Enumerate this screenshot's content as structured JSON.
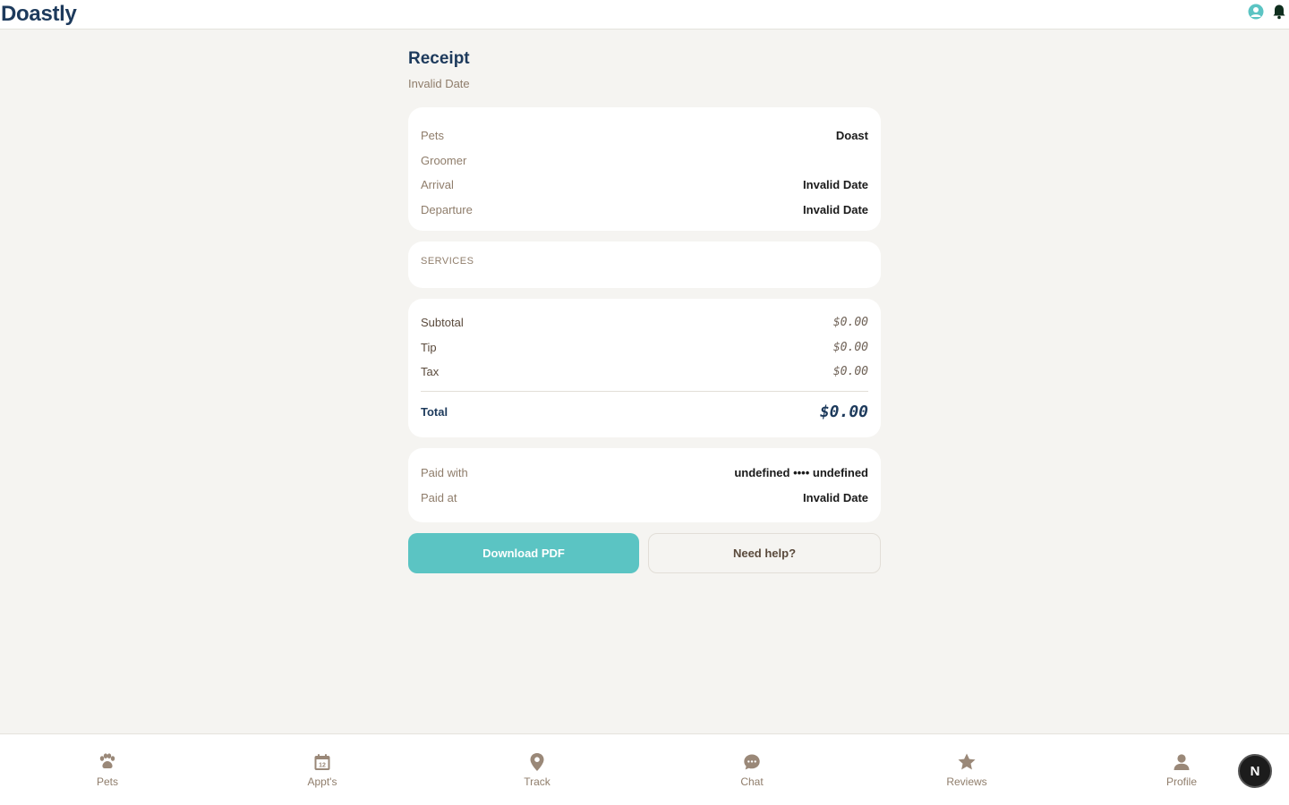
{
  "app": {
    "brand": "Doastly"
  },
  "header_icons": [
    "user-circle-icon",
    "bell-icon"
  ],
  "receipt": {
    "title": "Receipt",
    "date": "Invalid Date",
    "details": [
      {
        "label": "Pets",
        "value": "Doast"
      },
      {
        "label": "Groomer",
        "value": ""
      },
      {
        "label": "Arrival",
        "value": "Invalid Date"
      },
      {
        "label": "Departure",
        "value": "Invalid Date"
      }
    ],
    "services_label": "SERVICES",
    "totals": [
      {
        "label": "Subtotal",
        "value": "$0.00"
      },
      {
        "label": "Tip",
        "value": "$0.00"
      },
      {
        "label": "Tax",
        "value": "$0.00"
      }
    ],
    "total": {
      "label": "Total",
      "value": "$0.00"
    },
    "payment": [
      {
        "label": "Paid with",
        "value": "undefined •••• undefined"
      },
      {
        "label": "Paid at",
        "value": "Invalid Date"
      }
    ],
    "buttons": {
      "download": "Download PDF",
      "help": "Need help?"
    }
  },
  "nav": [
    {
      "label": "Pets",
      "icon": "paw-icon"
    },
    {
      "label": "Appt's",
      "icon": "calendar-icon"
    },
    {
      "label": "Track",
      "icon": "location-pin-icon"
    },
    {
      "label": "Chat",
      "icon": "chat-bubble-icon"
    },
    {
      "label": "Reviews",
      "icon": "star-icon"
    },
    {
      "label": "Profile",
      "icon": "person-icon"
    }
  ],
  "calendar_day": "12",
  "fab_label": "N",
  "colors": {
    "brand": "#1d3a5c",
    "accent": "#5bc4c3",
    "muted": "#8f7d6b"
  }
}
